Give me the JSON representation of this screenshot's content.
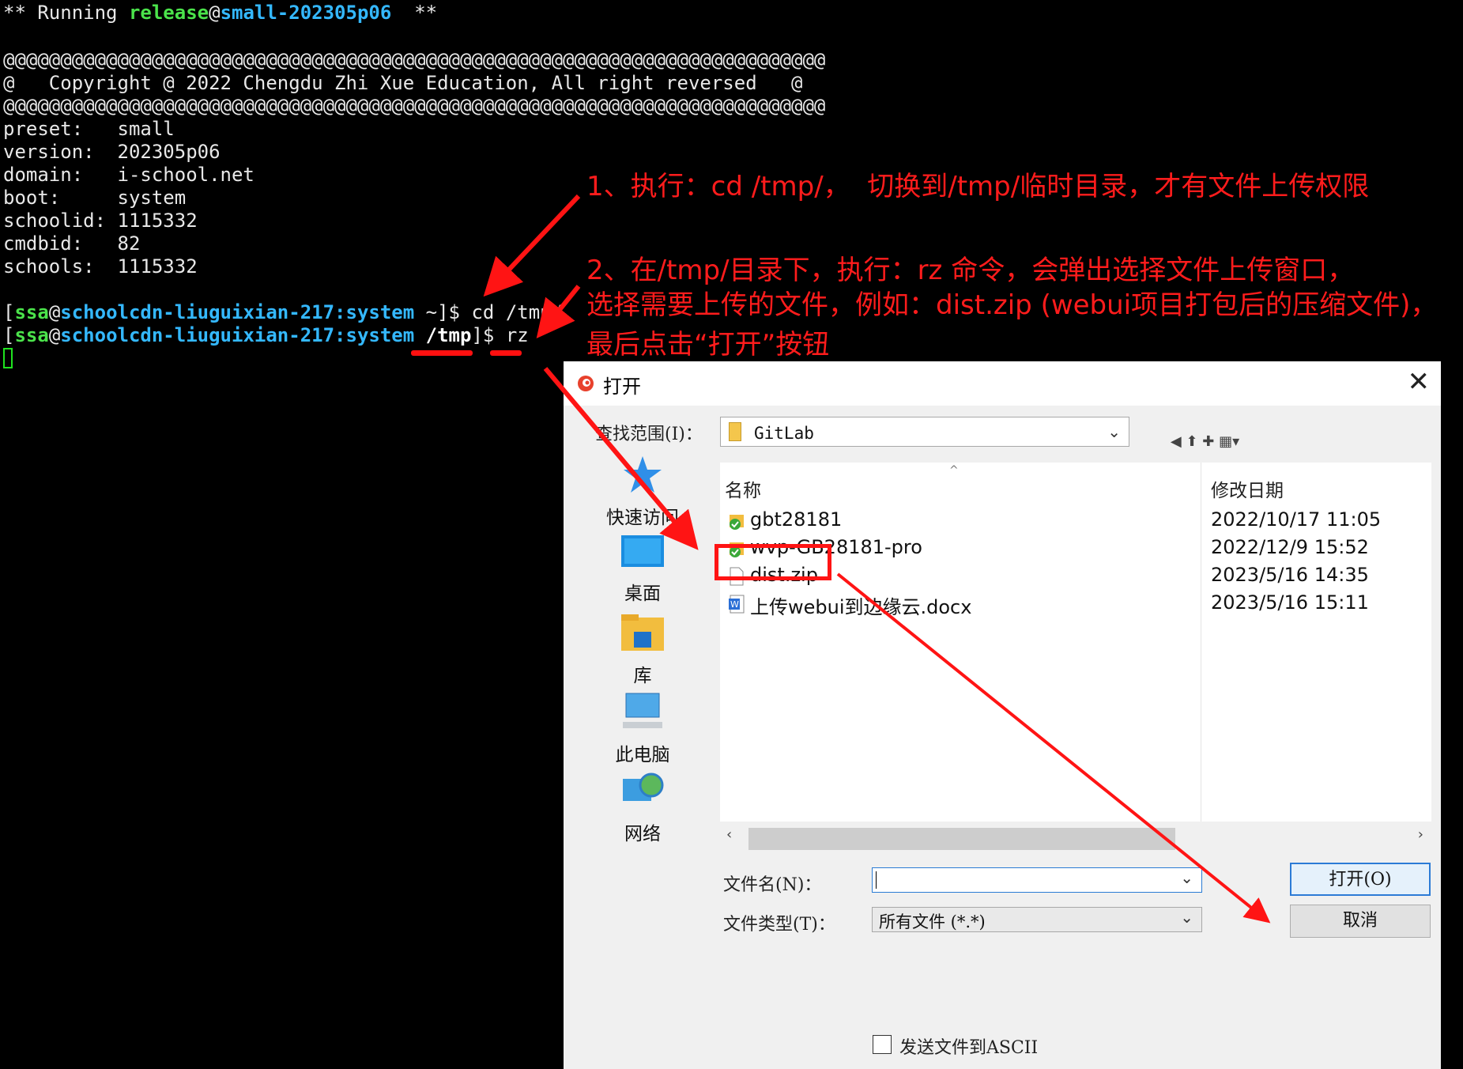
{
  "terminal": {
    "line0": {
      "a": "** Running ",
      "b": "release",
      "c": "@",
      "d": "small-202305p06",
      "e": "  **"
    },
    "at_line": "@@@@@@@@@@@@@@@@@@@@@@@@@@@@@@@@@@@@@@@@@@@@@@@@@@@@@@@@@@@@@@@@@@@@@@@@",
    "copyright": "@   Copyright @ 2022 Chengdu Zhi Xue Education, All right reversed   @",
    "info": [
      "preset:   small",
      "version:  202305p06",
      "domain:   i-school.net",
      "boot:     system",
      "schoolid: 1115332",
      "cmdbid:   82",
      "schools:  1115332"
    ],
    "prompt1": {
      "open": "[",
      "user": "ssa",
      "at": "@",
      "host": "schoolcdn-liuguixian-217:system",
      "dir": " ~",
      "close": "]$ ",
      "cmd": "cd /tmp/"
    },
    "prompt2": {
      "open": "[",
      "user": "ssa",
      "at": "@",
      "host": "schoolcdn-liuguixian-217:system",
      "dir": " /tmp",
      "close": "]$ ",
      "cmd": "rz"
    }
  },
  "annotations": {
    "step1": "1、执行：cd /tmp/，  切换到/tmp/临时目录，才有文件上传权限",
    "step2_l1": "2、在/tmp/目录下，执行：rz 命令，会弹出选择文件上传窗口，",
    "step2_l2": "选择需要上传的文件，例如：dist.zip (webui项目打包后的压缩文件)，",
    "step2_l3": "最后点击“打开”按钮"
  },
  "dialog": {
    "title": "打开",
    "close": "✕",
    "lookin_label": "查找范围(I)：",
    "lookin_value": "GitLab",
    "places": [
      "快速访问",
      "桌面",
      "库",
      "此电脑",
      "网络"
    ],
    "columns": {
      "name": "名称",
      "date": "修改日期"
    },
    "files": [
      {
        "name": "gbt28181",
        "date": "2022/10/17 11:05",
        "icon": "folder-sync-icon"
      },
      {
        "name": "wvp-GB28181-pro",
        "date": "2022/12/9 15:52",
        "icon": "folder-sync-icon"
      },
      {
        "name": "dist.zip",
        "date": "2023/5/16 14:35",
        "icon": "file-icon"
      },
      {
        "name": "上传webui到边缘云.docx",
        "date": "2023/5/16 15:11",
        "icon": "word-doc-icon"
      }
    ],
    "filename_label": "文件名(N)：",
    "filename_value": "",
    "filetype_label": "文件类型(T)：",
    "filetype_value": "所有文件 (*.*)",
    "open_button": "打开(O)",
    "cancel_button": "取消",
    "ascii_label": "发送文件到ASCII"
  },
  "colors": {
    "annotation": "#ff1c1c",
    "prompt_user": "#4be34b",
    "prompt_host": "#34b8ff"
  }
}
